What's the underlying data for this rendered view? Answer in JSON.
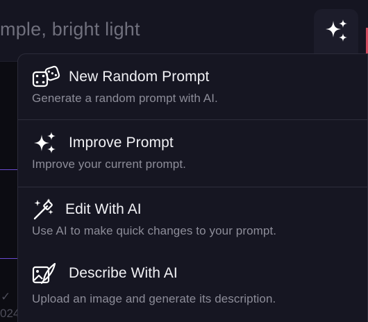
{
  "prompt": {
    "visible_text": "mple, bright light"
  },
  "background": {
    "fragment_bottom_left_1": "✓",
    "fragment_bottom_left_2": "024"
  },
  "menu": {
    "items": [
      {
        "icon": "dice-icon",
        "title": "New Random Prompt",
        "description": "Generate a random prompt with AI."
      },
      {
        "icon": "sparkles-icon",
        "title": "Improve Prompt",
        "description": "Improve your current prompt."
      },
      {
        "icon": "magic-wand-icon",
        "title": "Edit With AI",
        "description": "Use AI to make quick changes to your prompt."
      },
      {
        "icon": "image-pen-icon",
        "title": "Describe With AI",
        "description": "Upload an image and generate its description."
      }
    ]
  },
  "colors": {
    "menu_bg": "#161622",
    "accent_line": "#6a4bd1",
    "title_text": "#f1f1f5",
    "desc_text": "#8d8d99"
  }
}
